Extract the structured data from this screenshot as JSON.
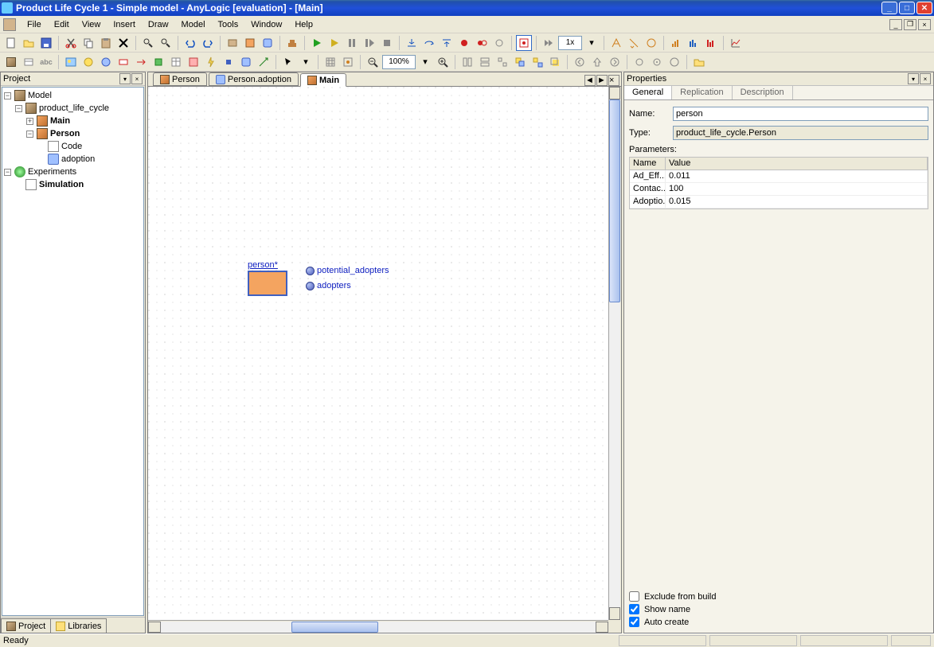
{
  "title": "Product Life Cycle 1 - Simple model - AnyLogic [evaluation] - [Main]",
  "menu": {
    "file": "File",
    "edit": "Edit",
    "view": "View",
    "insert": "Insert",
    "draw": "Draw",
    "model": "Model",
    "tools": "Tools",
    "window": "Window",
    "help": "Help"
  },
  "zoom": "100%",
  "projectPanel": {
    "title": "Project"
  },
  "tree": {
    "root": "Model",
    "pkg": "product_life_cycle",
    "main": "Main",
    "person": "Person",
    "code": "Code",
    "adoption": "adoption",
    "experiments": "Experiments",
    "simulation": "Simulation"
  },
  "leftTabs": {
    "project": "Project",
    "libraries": "Libraries"
  },
  "editorTabs": {
    "person": "Person",
    "personAdoption": "Person.adoption",
    "main": "Main"
  },
  "canvas": {
    "personLabel": "person*",
    "var1": "potential_adopters",
    "var2": "adopters"
  },
  "propertiesPanel": {
    "title": "Properties"
  },
  "propTabs": {
    "general": "General",
    "replication": "Replication",
    "description": "Description"
  },
  "props": {
    "nameLabel": "Name:",
    "nameValue": "person",
    "typeLabel": "Type:",
    "typeValue": "product_life_cycle.Person",
    "paramsLabel": "Parameters:",
    "colName": "Name",
    "colValue": "Value",
    "rows": [
      {
        "name": "Ad_Eff...",
        "value": "0.011"
      },
      {
        "name": "Contac...",
        "value": "100"
      },
      {
        "name": "Adoptio...",
        "value": "0.015"
      }
    ],
    "exclude": "Exclude from build",
    "showName": "Show name",
    "autoCreate": "Auto create"
  },
  "status": "Ready"
}
